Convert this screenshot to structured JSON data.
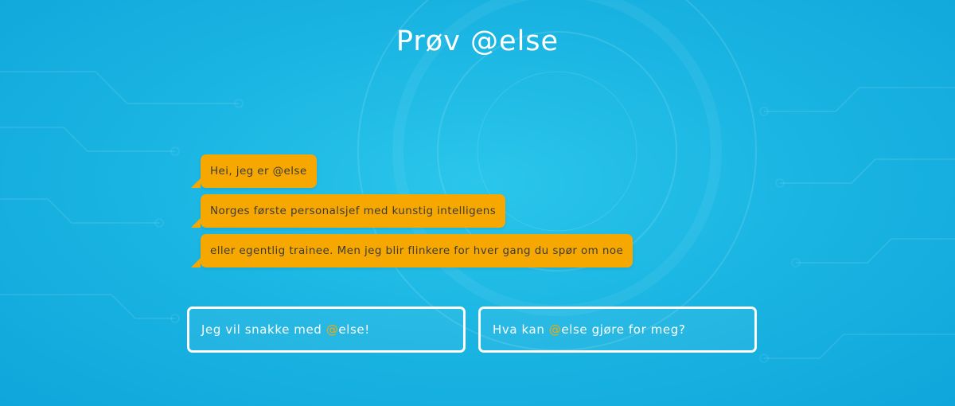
{
  "header": {
    "title": "Prøv @else"
  },
  "chat": {
    "messages": [
      "Hei, jeg er @else",
      "Norges første personalsjef med kunstig intelligens",
      "eller egentlig trainee. Men jeg blir flinkere for hver gang du spør om noe"
    ]
  },
  "choices": [
    {
      "before": "Jeg vil snakke med ",
      "at": "@",
      "after": "else!"
    },
    {
      "before": "Hva kan ",
      "at": "@",
      "after": "else gjøre for meg?"
    }
  ],
  "colors": {
    "background": "#1bb6e3",
    "bubble": "#f7a800",
    "accent": "#f7a800",
    "text_light": "#ffffff"
  }
}
